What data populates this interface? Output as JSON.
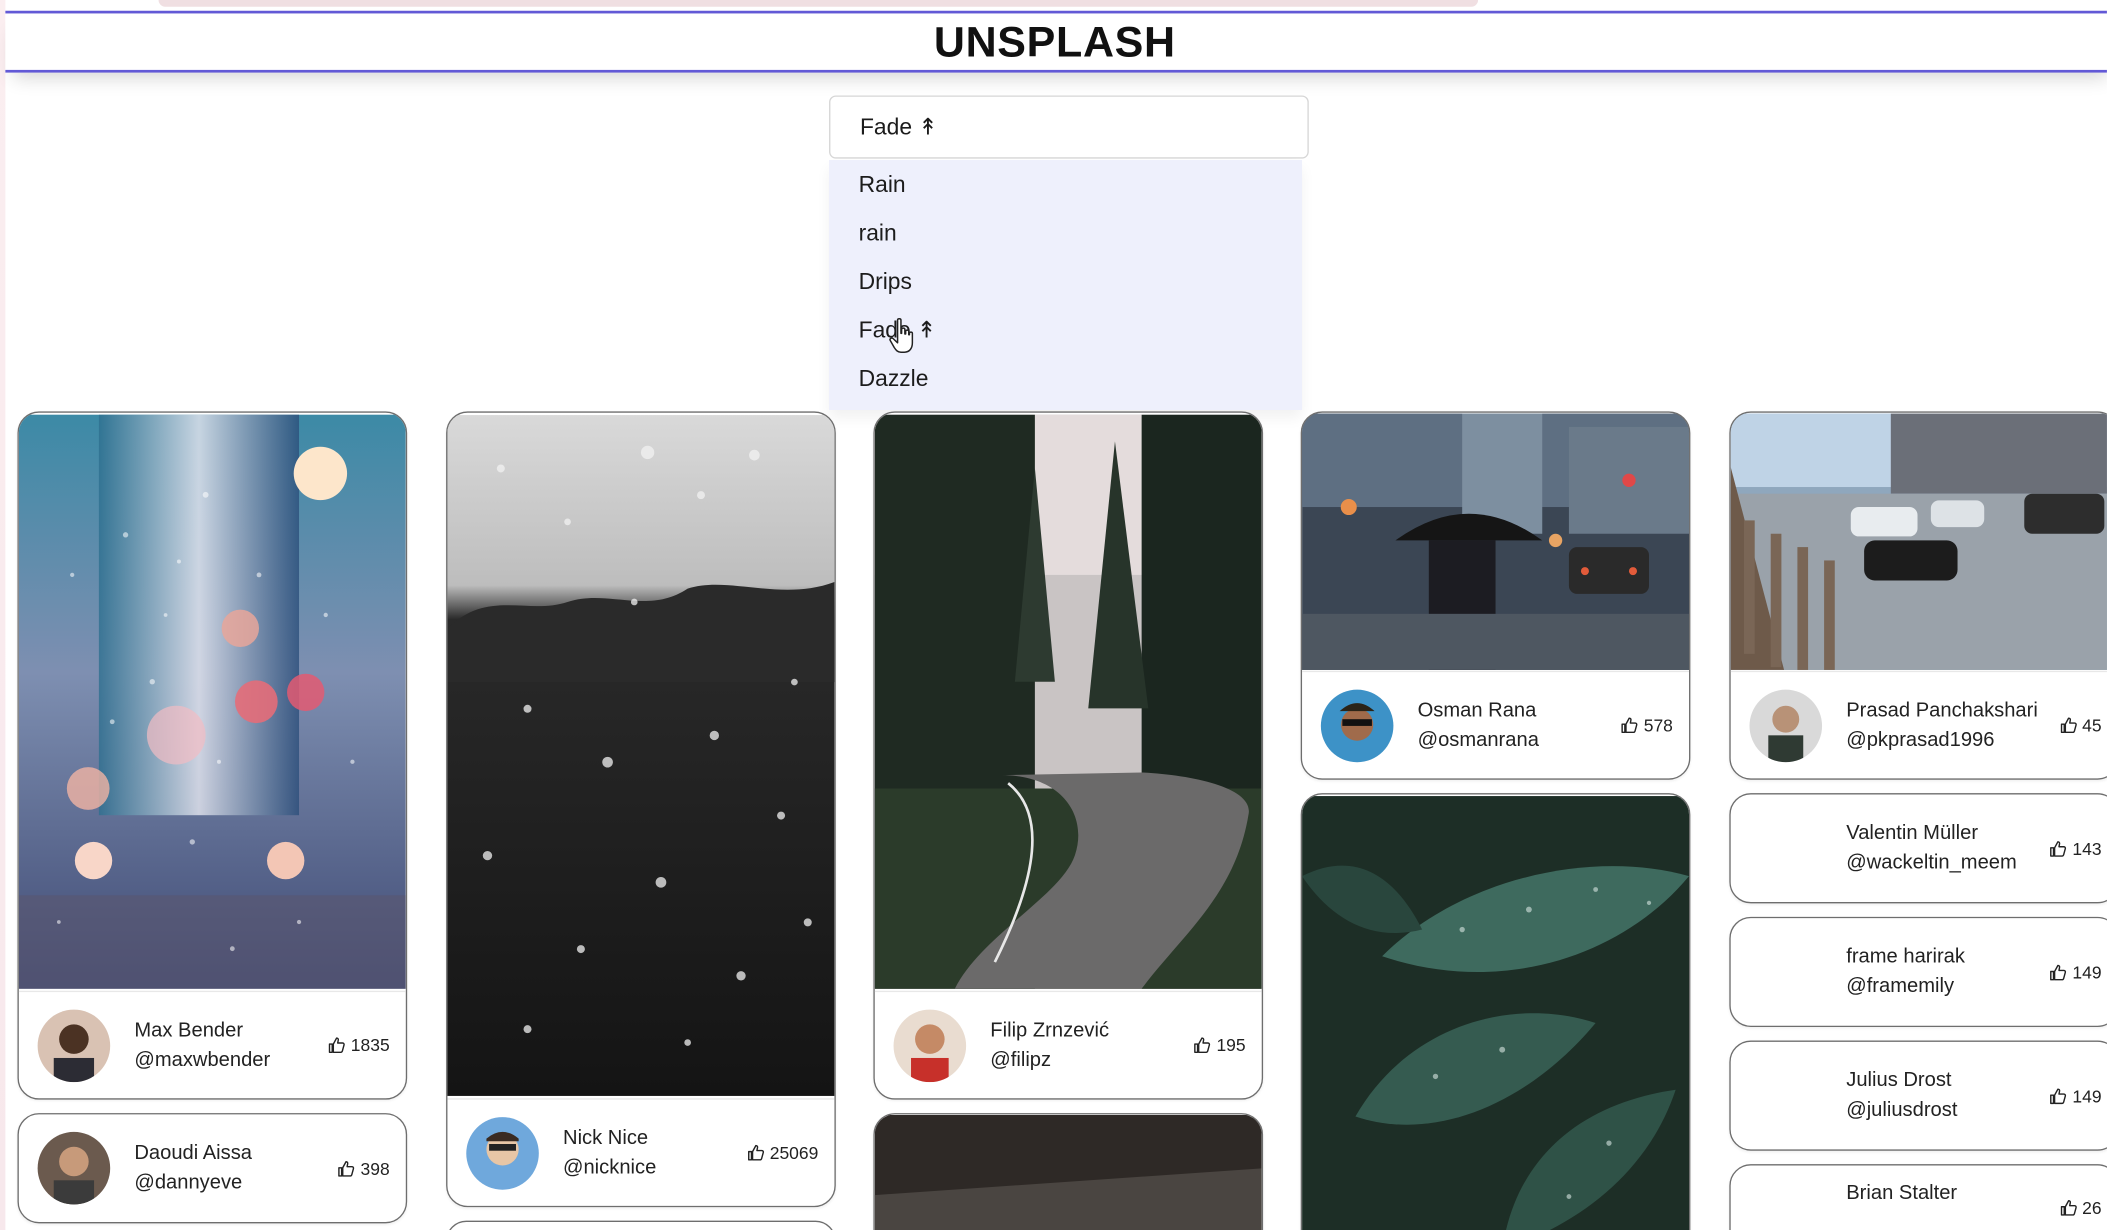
{
  "app": {
    "title": "UNSPLASH"
  },
  "search_select": {
    "selected": "Fade ↟",
    "options": [
      "Rain",
      "rain",
      "Drips",
      "Fade ↟",
      "Dazzle"
    ]
  },
  "columns": [
    [
      {
        "name": "Max Bender",
        "handle": "@maxwbender",
        "likes": "1835",
        "photo": "blurred-rain-window"
      },
      {
        "name": "Daoudi Aissa",
        "handle": "@dannyeve",
        "likes": "398",
        "photo": "none"
      }
    ],
    [
      {
        "name": "Nick Nice",
        "handle": "@nicknice",
        "likes": "25069",
        "photo": "rain-drops-dark"
      }
    ],
    [
      {
        "name": "Filip Zrnzević",
        "handle": "@filipz",
        "likes": "195",
        "photo": "forest-road"
      }
    ],
    [
      {
        "name": "Osman Rana",
        "handle": "@osmanrana",
        "likes": "578",
        "photo": "city-rain-umbrella"
      }
    ],
    [
      {
        "name": "Prasad Panchakshari",
        "handle": "@pkprasad1996",
        "likes": "45",
        "photo": "traffic-bridge"
      },
      {
        "name": "Valentin Müller",
        "handle": "@wackeltin_meem",
        "likes": "143",
        "photo": "none"
      },
      {
        "name": "frame harirak",
        "handle": "@framemily",
        "likes": "149",
        "photo": "none"
      },
      {
        "name": "Julius Drost",
        "handle": "@juliusdrost",
        "likes": "149",
        "photo": "none"
      },
      {
        "name": "Brian Stalter",
        "handle": "",
        "likes": "26",
        "photo": "none"
      }
    ]
  ],
  "icons": {
    "like": "thumbs-up-icon"
  },
  "colors": {
    "header_border": "#6259d6",
    "menu_bg": "#eef0fc",
    "card_border": "#6e6e6e"
  }
}
